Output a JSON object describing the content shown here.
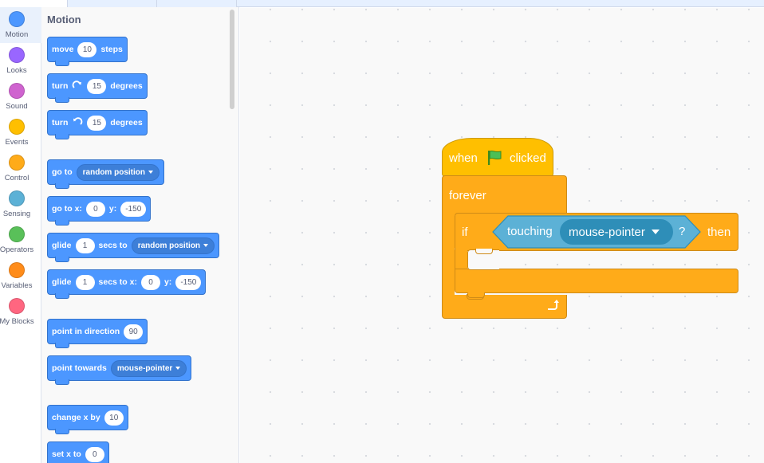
{
  "categories": [
    {
      "label": "Motion",
      "color": "#4c97ff"
    },
    {
      "label": "Looks",
      "color": "#9966ff"
    },
    {
      "label": "Sound",
      "color": "#cf63cf"
    },
    {
      "label": "Events",
      "color": "#ffbf00"
    },
    {
      "label": "Control",
      "color": "#ffab19"
    },
    {
      "label": "Sensing",
      "color": "#5cb1d6"
    },
    {
      "label": "Operators",
      "color": "#59c059"
    },
    {
      "label": "Variables",
      "color": "#ff8c1a"
    },
    {
      "label": "My Blocks",
      "color": "#ff6680"
    }
  ],
  "palette": {
    "heading": "Motion",
    "move": {
      "a": "move",
      "n": "10",
      "b": "steps"
    },
    "turn_right": {
      "a": "turn",
      "icon": "rotate-right-icon",
      "n": "15",
      "b": "degrees"
    },
    "turn_left": {
      "a": "turn",
      "icon": "rotate-left-icon",
      "n": "15",
      "b": "degrees"
    },
    "goto": {
      "a": "go to",
      "dd": "random position"
    },
    "goto_xy": {
      "a": "go to x:",
      "x": "0",
      "b": "y:",
      "y": "-150"
    },
    "glide": {
      "a": "glide",
      "n": "1",
      "b": "secs to",
      "dd": "random position"
    },
    "glide_xy": {
      "a": "glide",
      "n": "1",
      "b": "secs to x:",
      "x": "0",
      "c": "y:",
      "y": "-150"
    },
    "point_dir": {
      "a": "point in direction",
      "n": "90"
    },
    "point_towards": {
      "a": "point towards",
      "dd": "mouse-pointer"
    },
    "change_x": {
      "a": "change x by",
      "n": "10"
    },
    "set_x": {
      "a": "set x to",
      "n": "0"
    }
  },
  "script": {
    "hat": {
      "a": "when",
      "icon": "green-flag-icon",
      "b": "clicked"
    },
    "forever": "forever",
    "if_label": "if",
    "then_label": "then",
    "touching": {
      "a": "touching",
      "dd": "mouse-pointer",
      "q": "?"
    }
  },
  "colors": {
    "motion": "#4c97ff",
    "events": "#ffbf00",
    "control": "#ffab19",
    "sensing": "#5cb1d6"
  }
}
